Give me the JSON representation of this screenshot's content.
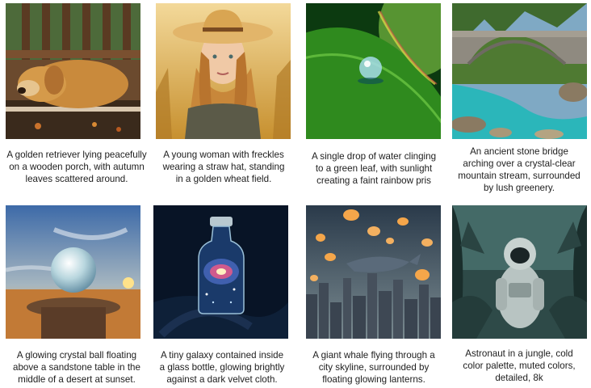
{
  "gallery": {
    "items": [
      {
        "caption": "A golden retriever lying peacefully\non a wooden porch, with autumn\nleaves scattered around.",
        "icon": "dog-image"
      },
      {
        "caption": "A young woman with freckles\nwearing a straw hat, standing\nin a golden wheat field.",
        "icon": "woman-image"
      },
      {
        "caption": "A single drop of water clinging\nto a green leaf, with sunlight\ncreating a faint rainbow pris",
        "icon": "water-drop-image"
      },
      {
        "caption": "An ancient stone bridge\narching over a crystal-clear\nmountain stream, surrounded\nby lush greenery.",
        "icon": "bridge-image"
      },
      {
        "caption": "A glowing crystal ball floating\nabove a sandstone table in the\nmiddle of a desert at sunset.",
        "icon": "crystal-ball-image"
      },
      {
        "caption": "A tiny galaxy contained inside\na glass bottle, glowing brightly\nagainst a dark velvet cloth.",
        "icon": "galaxy-bottle-image"
      },
      {
        "caption": "A giant whale flying through a\ncity skyline, surrounded by\nfloating glowing lanterns.",
        "icon": "flying-whale-image"
      },
      {
        "caption": "Astronaut in a jungle, cold\ncolor palette, muted colors,\ndetailed, 8k",
        "icon": "astronaut-image"
      }
    ]
  }
}
